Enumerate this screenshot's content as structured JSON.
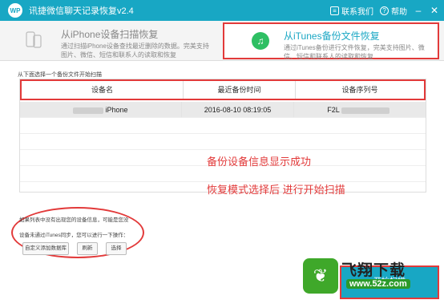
{
  "titlebar": {
    "logo": "WP",
    "title": "讯捷微信聊天记录恢复v2.4",
    "contact_label": "联系我们",
    "help_label": "帮助"
  },
  "modes": {
    "iphone": {
      "title": "从iPhone设备扫描恢复",
      "desc": "通过扫描iPhone设备查找最近删除的数据。完美支持图片、微信、短信和联系人的读取和恢复"
    },
    "itunes": {
      "title": "从iTunes备份文件恢复",
      "desc": "通过iTunes备份进行文件恢复，完美支持图片、微信、短信和联系人的读取和恢复"
    }
  },
  "hint": "从下面选择一个备份文件开始扫描",
  "table": {
    "headers": [
      "设备名",
      "最近备份时间",
      "设备序列号"
    ],
    "rows": [
      {
        "device": "iPhone",
        "time": "2016-08-10  08:19:05",
        "serial": "F2L"
      }
    ]
  },
  "annotations": {
    "line1": "备份设备信息显示成功",
    "line2": "恢复模式选择后 进行开始扫描"
  },
  "bottom": {
    "note": "如果列表中没有出现您的设备信息，可能是您没",
    "sync_note": "设备未通过iTunes同步，您可以进行一下操作：",
    "btn_custom": "自定义添加数据库",
    "btn_refresh": "刷新",
    "btn_select": "选择"
  },
  "start_label": "开始扫描",
  "watermark": {
    "text": "飞翔下载",
    "url": "www.52z.com"
  },
  "colors": {
    "accent": "#18a7c4",
    "annotation": "#e23a3a",
    "itunes_icon": "#2ebf63"
  }
}
